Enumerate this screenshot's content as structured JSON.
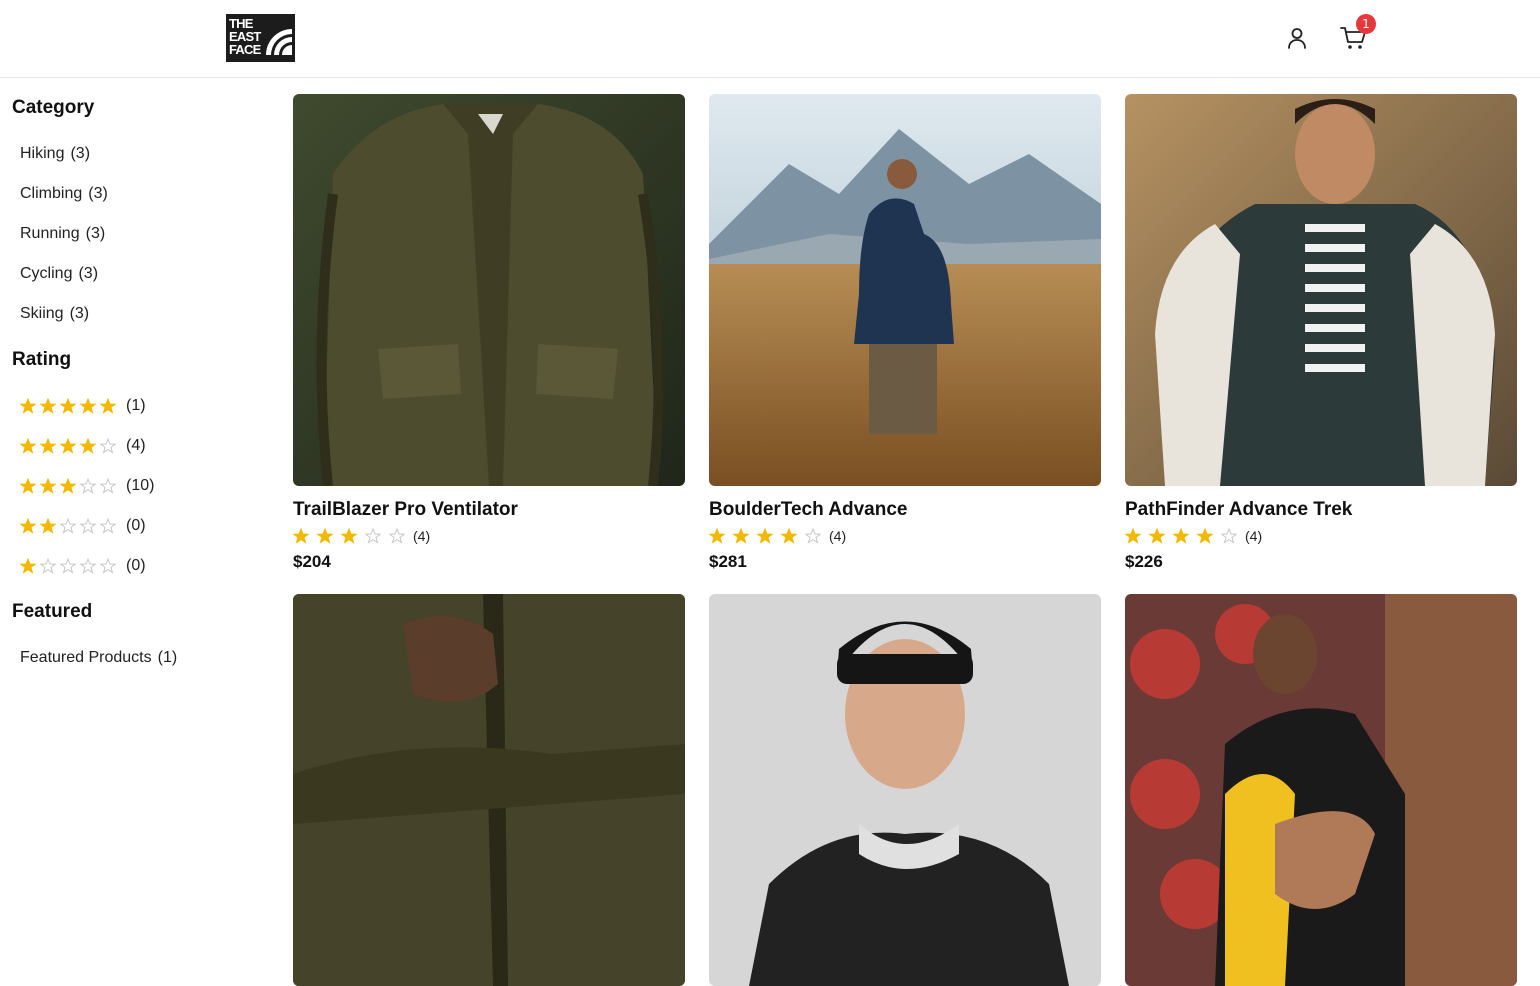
{
  "header": {
    "logo_text": "THE\nEAST\nFACE",
    "cart_count": "1"
  },
  "sidebar": {
    "category_heading": "Category",
    "categories": [
      {
        "label": "Hiking",
        "count": "(3)"
      },
      {
        "label": "Climbing",
        "count": "(3)"
      },
      {
        "label": "Running",
        "count": "(3)"
      },
      {
        "label": "Cycling",
        "count": "(3)"
      },
      {
        "label": "Skiing",
        "count": "(3)"
      }
    ],
    "rating_heading": "Rating",
    "ratings": [
      {
        "stars": 5,
        "count": "(1)"
      },
      {
        "stars": 4,
        "count": "(4)"
      },
      {
        "stars": 3,
        "count": "(10)"
      },
      {
        "stars": 2,
        "count": "(0)"
      },
      {
        "stars": 1,
        "count": "(0)"
      }
    ],
    "featured_heading": "Featured",
    "featured": [
      {
        "label": "Featured Products",
        "count": "(1)"
      }
    ]
  },
  "products": [
    {
      "title": "TrailBlazer Pro Ventilator",
      "stars": 3,
      "reviews": "(4)",
      "price": "$204",
      "image": "olive-jacket-closeup"
    },
    {
      "title": "BoulderTech Advance",
      "stars": 4,
      "reviews": "(4)",
      "price": "$281",
      "image": "man-in-field-mountains"
    },
    {
      "title": "PathFinder Advance Trek",
      "stars": 4,
      "reviews": "(4)",
      "price": "$226",
      "image": "smiling-man-varsity-jacket"
    },
    {
      "title": "",
      "stars": 0,
      "reviews": "",
      "price": "",
      "image": "olive-jacket-zip-detail"
    },
    {
      "title": "",
      "stars": 0,
      "reviews": "",
      "price": "",
      "image": "man-black-beanie"
    },
    {
      "title": "",
      "stars": 0,
      "reviews": "",
      "price": "",
      "image": "man-yellow-jacket-mural"
    }
  ],
  "colors": {
    "star": "#f5b800",
    "star_empty": "#c8c8c8",
    "badge": "#e5383b",
    "text": "#111111"
  }
}
